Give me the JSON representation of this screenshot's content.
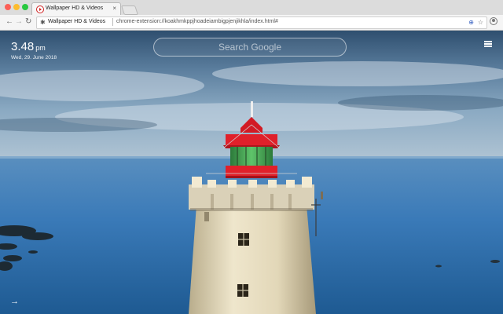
{
  "browser": {
    "tab": {
      "title": "Wallpaper HD & Videos",
      "close": "×"
    },
    "omnibox": {
      "site_name": "Wallpaper HD & Videos",
      "url": "chrome-extension://koakhmkppjhoadeiambigpjenjikhla/index.html#"
    },
    "icons": {
      "back": "←",
      "forward": "→",
      "reload": "↻",
      "extension": "✱",
      "lens": "⊕",
      "star": "☆"
    }
  },
  "page": {
    "clock": {
      "time": "3.48",
      "period": "pm",
      "date": "Wed, 29. June 2018"
    },
    "search": {
      "placeholder": "Search Google"
    },
    "arrow": "→"
  },
  "colors": {
    "lantern_red": "#e0202a",
    "lantern_green": "#3ea64a",
    "sea": "#3a7ab8",
    "sky": "#6e96b8",
    "tower": "#e8dfc4"
  }
}
